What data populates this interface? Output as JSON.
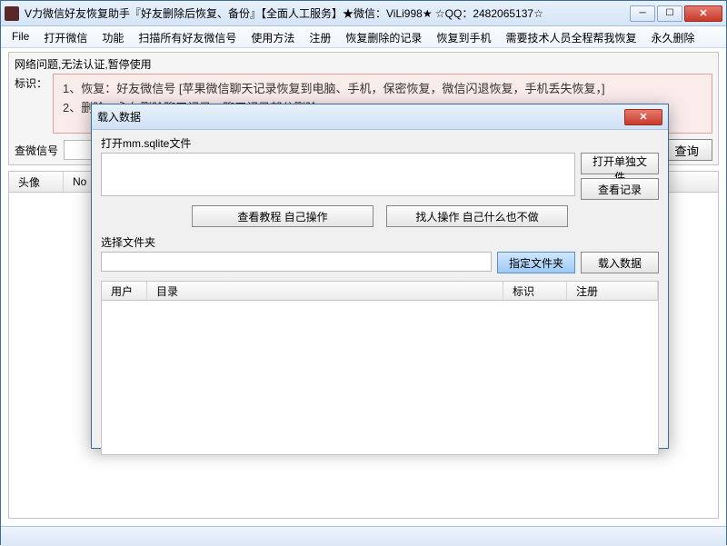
{
  "window": {
    "title": "V力微信好友恢复助手『好友删除后恢复、备份』【全面人工服务】★微信：ViLi998★ ☆QQ：2482065137☆"
  },
  "menu": {
    "file": "File",
    "open_wechat": "打开微信",
    "function": "功能",
    "scan_all": "扫描所有好友微信号",
    "usage": "使用方法",
    "register": "注册",
    "recover_deleted": "恢复删除的记录",
    "recover_to_phone": "恢复到手机",
    "need_tech": "需要技术人员全程帮我恢复",
    "perm_delete": "永久删除"
  },
  "top": {
    "status": "网络问题,无法认证,暂停使用",
    "marker_label": "标识：",
    "info_line1": "1、恢复：好友微信号 [苹果微信聊天记录恢复到电脑、手机，保密恢复，微信闪退恢复，手机丢失恢复，]",
    "info_line2": "2、删除：永久删除聊天记录，聊天记录部分删除 。",
    "search_label": "查微信号",
    "search_btn": "查询"
  },
  "grid": {
    "col_avatar": "头像",
    "col_no": "No"
  },
  "dialog": {
    "title": "载入数据",
    "open_file_label": "打开mm.sqlite文件",
    "btn_open_single": "打开单独文件",
    "btn_view_records": "查看记录",
    "btn_tutorial": "查看教程 自己操作",
    "btn_find_person": "找人操作 自己什么也不做",
    "select_folder_label": "选择文件夹",
    "btn_specify_folder": "指定文件夹",
    "btn_load_data": "载入数据",
    "col_user": "用户",
    "col_dir": "目录",
    "col_marker": "标识",
    "col_register": "注册"
  }
}
